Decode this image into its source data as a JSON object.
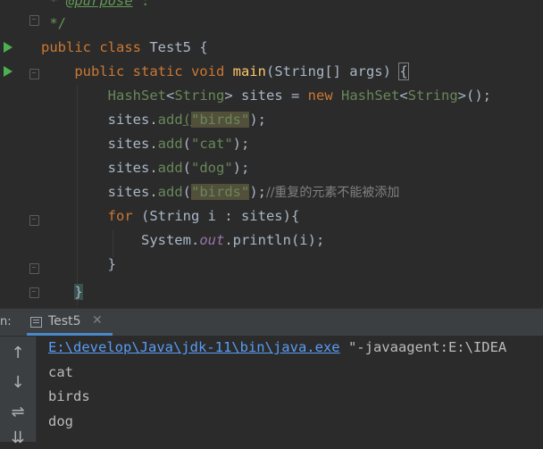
{
  "editor": {
    "line0": {
      "prefix": " * ",
      "tag": "@purpose",
      "rest": " :"
    },
    "line1": " */",
    "line2": {
      "kw": "public class ",
      "name": "Test5",
      "rest": " {"
    },
    "line3": {
      "indent": "    ",
      "kw": "public static void ",
      "fn": "main",
      "open": "(",
      "type": "String",
      "rest": "[] args) ",
      "brace": "{"
    },
    "line4": {
      "indent": "        ",
      "t1": "HashSet",
      "lt1": "<",
      "t2": "String",
      "gt1": "> sites = ",
      "kw": "new",
      "sp": " ",
      "t3": "HashSet",
      "lt2": "<",
      "t4": "String",
      "end": ">();"
    },
    "line5": {
      "indent": "        ",
      "pre": "sites.",
      "m": "add",
      "open": "(",
      "str": "\"birds\"",
      "end": ");"
    },
    "line6": {
      "indent": "        ",
      "pre": "sites.",
      "m": "add",
      "open": "(",
      "str": "\"cat\"",
      "end": ");"
    },
    "line7": {
      "indent": "        ",
      "pre": "sites.",
      "m": "add",
      "open": "(",
      "str": "\"dog\"",
      "end": ");"
    },
    "line8": {
      "indent": "        ",
      "pre": "sites.",
      "m": "add",
      "open": "(",
      "str": "\"birds\"",
      "end": ");",
      "comment": "//重复的元素不能被添加"
    },
    "line9": {
      "indent": "        ",
      "kw": "for",
      "rest": " (String i : sites){"
    },
    "line10": {
      "indent": "            ",
      "cls": "System.",
      "field": "out",
      "rest": ".println(i);"
    },
    "line11": {
      "indent": "        ",
      "text": "}"
    },
    "line12": {
      "indent": "    ",
      "text": "}"
    }
  },
  "run_panel": {
    "label": "n:",
    "tab_label": "Test5",
    "tab_close": "✕"
  },
  "console": {
    "command_path": "E:\\develop\\Java\\jdk-11\\bin\\java.exe",
    "command_rest": " \"-javaagent:E:\\IDEA",
    "output": [
      "cat",
      "birds",
      "dog"
    ]
  },
  "side_toolbar": {
    "up": "↑",
    "down": "↓",
    "wrap": "⇌",
    "sort": "⇊"
  },
  "colors": {
    "background": "#2b2b2b",
    "keyword": "#cc7832",
    "string": "#6a8759",
    "method": "#ffc66d",
    "field": "#9876aa",
    "comment": "#808080",
    "link": "#589df6",
    "run_green": "#4caf50"
  }
}
